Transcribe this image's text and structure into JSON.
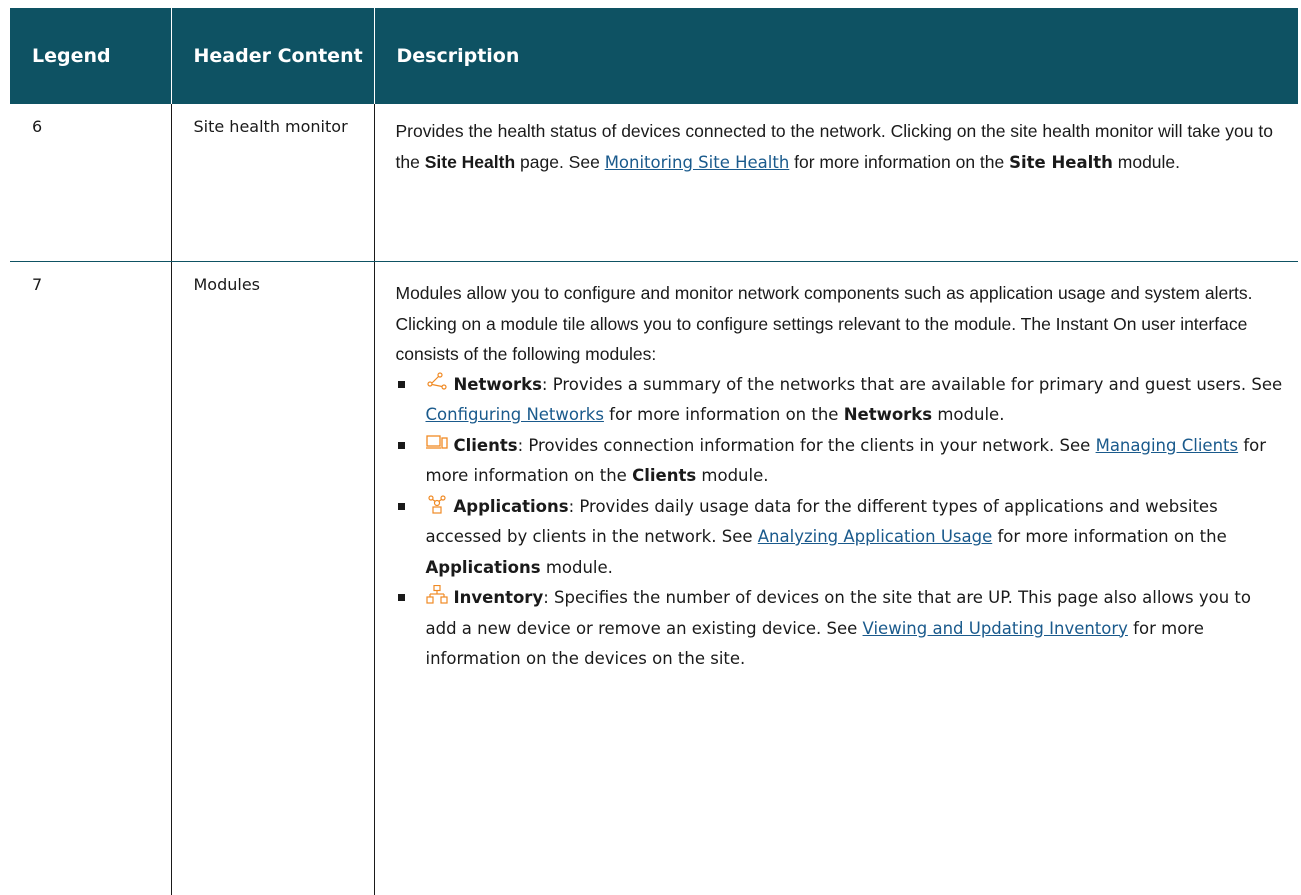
{
  "table": {
    "headers": {
      "legend": "Legend",
      "header_content": "Header Content",
      "description": "Description"
    },
    "rows": [
      {
        "legend": "6",
        "header_content": "Site health monitor",
        "desc": {
          "p1": "Provides the health status of devices connected to the network. Clicking on the site health monitor will take you to the ",
          "b1": "Site Health",
          "p2": " page. See ",
          "link": "Monitoring Site Health",
          "p3": " for more information on the ",
          "b2": "Site Health",
          "p4": " module."
        }
      },
      {
        "legend": "7",
        "header_content": "Modules",
        "desc": {
          "intro": "Modules allow you to configure and monitor network components such as application usage and system alerts. Clicking on a module tile allows you to configure settings relevant to the module. The Instant On user interface consists of the following modules:",
          "items": [
            {
              "icon": "networks-icon",
              "icon_color": "#f08a24",
              "name": "Networks",
              "t1": ": Provides a summary of the networks that are available for primary and guest users. See ",
              "link": "Configuring Networks",
              "t2": " for more information on the ",
              "bold": "Networks",
              "t3": " module."
            },
            {
              "icon": "clients-icon",
              "icon_color": "#f08a24",
              "name": "Clients",
              "t1": ": Provides connection information for the clients in your network. See ",
              "link": "Managing Clients",
              "t2": " for more information on the ",
              "bold": "Clients",
              "t3": " module."
            },
            {
              "icon": "applications-icon",
              "icon_color": "#f08a24",
              "name": "Applications",
              "t1": ": Provides daily usage data for the different types of applications and websites accessed by clients in the network. See ",
              "link": "Analyzing Application Usage",
              "t2": " for more information on the ",
              "bold": "Applications",
              "t3": " module."
            },
            {
              "icon": "inventory-icon",
              "icon_color": "#f08a24",
              "name": "Inventory",
              "t1": ": Specifies the number of devices on the site that are UP. This page also allows you to add a new device or remove an existing device. See ",
              "link": "Viewing and Updating Inventory",
              "t2": " for more information on the devices on the site.",
              "bold": "",
              "t3": ""
            }
          ]
        }
      }
    ]
  },
  "colors": {
    "header_bg": "#0e5263",
    "link": "#1a5a8c",
    "icon_accent": "#f08a24"
  }
}
